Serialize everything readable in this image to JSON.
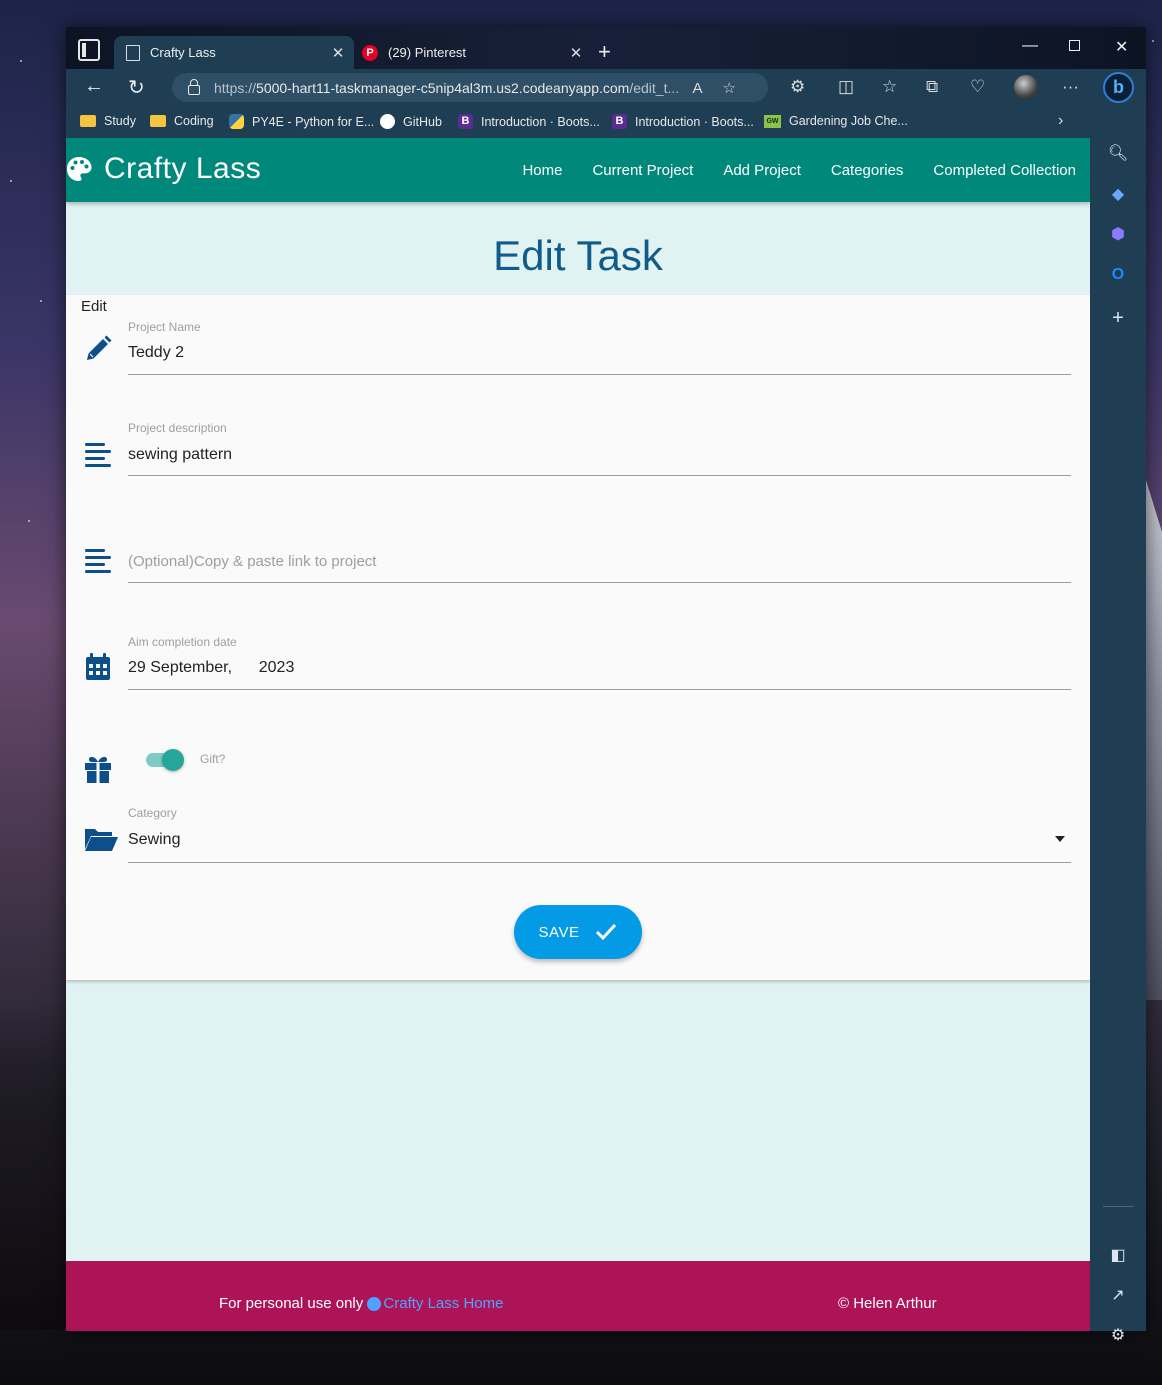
{
  "browser": {
    "tabs": [
      {
        "title": "Crafty Lass",
        "active": true
      },
      {
        "title": "(29) Pinterest",
        "active": false
      }
    ],
    "url_prefix": "https://",
    "url_host": "5000-hart11-taskmanager-c5nip4al3m.us2.codeanyapp.com",
    "url_path": "/edit_t...",
    "bookmarks": [
      "Study",
      "Coding",
      "PY4E - Python for E...",
      "GitHub",
      "Introduction · Boots...",
      "Introduction · Boots...",
      "Gardening Job Che..."
    ]
  },
  "app": {
    "brand": "Crafty Lass",
    "nav": [
      "Home",
      "Current Project",
      "Add Project",
      "Categories",
      "Completed Collection"
    ]
  },
  "form": {
    "page_title": "Edit Task",
    "section_label": "Edit",
    "project_name": {
      "label": "Project Name",
      "value": "Teddy 2"
    },
    "project_description": {
      "label": "Project description",
      "value": "sewing pattern"
    },
    "project_link": {
      "placeholder": "(Optional)Copy & paste link to project"
    },
    "due_date": {
      "label": "Aim completion date",
      "value": "29 September,      2023"
    },
    "gift": {
      "label": "Gift?",
      "checked": true
    },
    "category": {
      "label": "Category",
      "value": "Sewing"
    },
    "save_label": "SAVE"
  },
  "footer": {
    "left_text": "For personal use only",
    "link_text": "Crafty Lass Home",
    "copyright": "© Helen Arthur"
  },
  "colors": {
    "appbar": "#00897b",
    "title": "#0f5c8c",
    "save": "#039be5",
    "footer": "#ad1457",
    "icon": "#0d4f8b"
  }
}
